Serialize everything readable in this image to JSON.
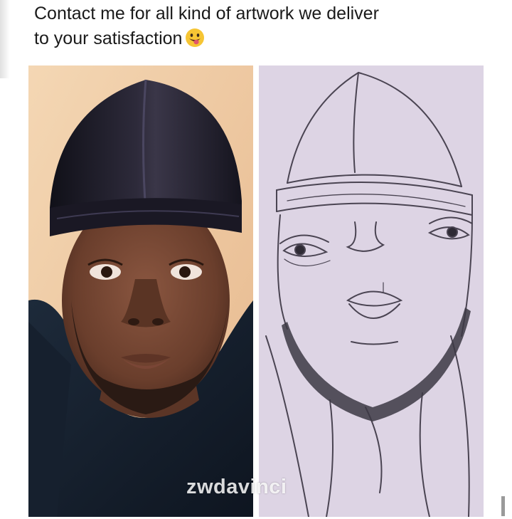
{
  "caption": {
    "line1": "Contact me for all kind of artwork we deliver",
    "line2": "to your satisfaction"
  },
  "emoji_icon": "grinning-tongue-face-icon",
  "watermark": "zwdavinci",
  "colors": {
    "background": "#ffffff",
    "photo_backdrop": "#f0c9a4",
    "durag": "#1c1a26",
    "skin": "#6e4330",
    "sketch_paper": "#ddd3e3",
    "sketch_line": "#4a4452"
  }
}
